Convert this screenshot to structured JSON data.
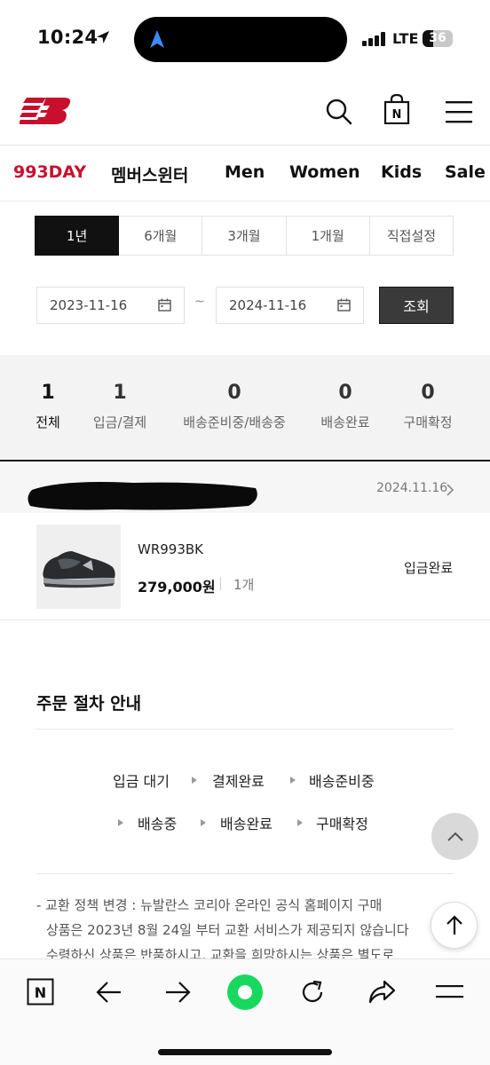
{
  "status_bar": {
    "time": "10:24",
    "network": "LTE",
    "battery": "36",
    "battery_level": 0.36
  },
  "header": {
    "logo_icon": "new-balance-logo",
    "icons": [
      "search-icon",
      "shopping-bag-icon",
      "menu-icon"
    ],
    "bag_letter": "N"
  },
  "category_nav": [
    {
      "label": "993DAY",
      "accent": true
    },
    {
      "label": "멤버스윈터",
      "accent": false
    },
    {
      "label": "Men",
      "accent": false
    },
    {
      "label": "Women",
      "accent": false
    },
    {
      "label": "Kids",
      "accent": false
    },
    {
      "label": "Sale",
      "accent": false
    }
  ],
  "period_tabs": [
    {
      "label": "1년",
      "active": true
    },
    {
      "label": "6개월",
      "active": false
    },
    {
      "label": "3개월",
      "active": false
    },
    {
      "label": "1개월",
      "active": false
    },
    {
      "label": "직접설정",
      "active": false
    }
  ],
  "date_range": {
    "start": "2023-11-16",
    "separator": "~",
    "end": "2024-11-16",
    "search_label": "조회"
  },
  "summary": [
    {
      "count": "1",
      "label": "전체"
    },
    {
      "count": "1",
      "label": "입금/결제"
    },
    {
      "count": "0",
      "label": "배송준비중/배송중"
    },
    {
      "count": "0",
      "label": "배송완료"
    },
    {
      "count": "0",
      "label": "구매확정"
    }
  ],
  "order": {
    "date": "2024.11.16",
    "product": {
      "name": "WR993BK",
      "price": "279,000원",
      "quantity": "1개",
      "status": "입금완료"
    }
  },
  "guide": {
    "title": "주문 절차 안내",
    "steps_row1": [
      "입금 대기",
      "결제완료",
      "배송준비중"
    ],
    "steps_row2": [
      "배송중",
      "배송완료",
      "구매확정"
    ]
  },
  "notice_lines": [
    "- 교환 정책 변경 : 뉴발란스 코리아 온라인 공식 홈페이지 구매",
    "상품은 2023년 8월 24일 부터 교환 서비스가 제공되지 않습니다",
    "수령하신 상품은 반품하시고, 교환을 희망하시는 상품은 별도로"
  ],
  "browser_toolbar": {
    "icons": [
      "naver-n-icon",
      "back-arrow-icon",
      "forward-arrow-icon",
      "green-dot-icon",
      "reload-icon",
      "share-icon",
      "menu-icon"
    ],
    "n_letter": "N"
  },
  "colors": {
    "accent": "#c8102e",
    "dark": "#111111",
    "green": "#19d85f"
  }
}
